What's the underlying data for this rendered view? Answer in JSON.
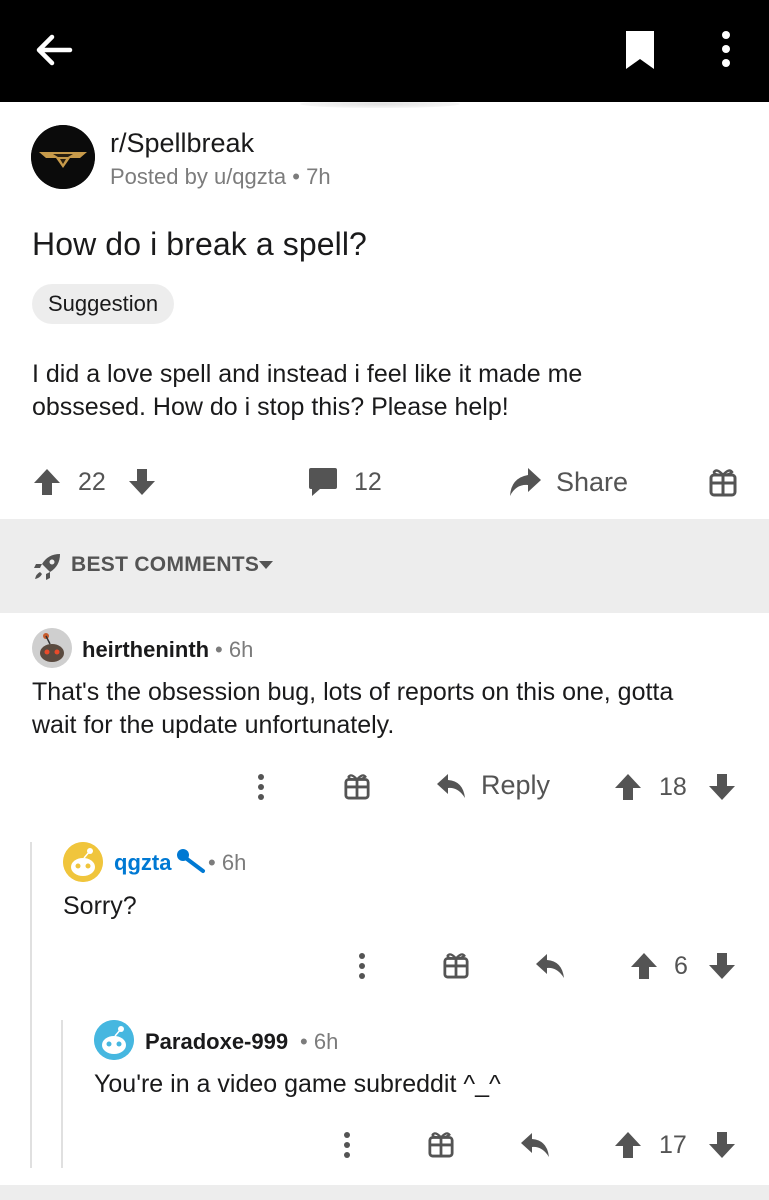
{
  "topbar": {
    "back_icon": "arrow-left-icon",
    "bookmark_icon": "bookmark-icon",
    "more_icon": "more-vertical-icon"
  },
  "post": {
    "subreddit": "r/Spellbreak",
    "posted_by": "Posted by u/qgzta",
    "age": "7h",
    "title": "How do i break a spell?",
    "flair": "Suggestion",
    "body_line1": "I did a love spell and instead i feel like it made me",
    "body_line2": "obssesed. How do i stop this? Please help!",
    "score": "22",
    "comments": "12",
    "share_label": "Share"
  },
  "sort": {
    "label": "BEST COMMENTS"
  },
  "comments": [
    {
      "author": "heirtheninth",
      "age": "6h",
      "body_line1": "That's the obsession bug, lots of reports on this one, gotta",
      "body_line2": "wait for the update unfortunately.",
      "reply_label": "Reply",
      "score": "18"
    },
    {
      "author": "qgzta",
      "age": "6h",
      "body": "Sorry?",
      "score": "6"
    },
    {
      "author": "Paradoxe-999",
      "age": "6h",
      "body": "You're in a video game subreddit ^_^",
      "score": "17"
    }
  ],
  "colors": {
    "topbar": "#000000",
    "op_author": "#0079d3",
    "muted": "#7c7c7c",
    "icon": "#545454",
    "sort_bg": "#ededed"
  }
}
